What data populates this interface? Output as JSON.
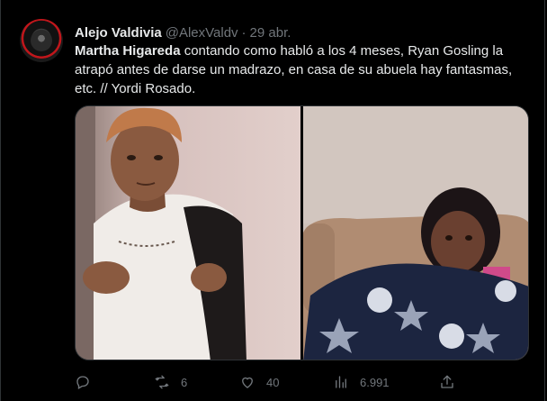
{
  "tweet": {
    "author_name": "Alejo Valdivia",
    "author_handle": "@AlexValdv",
    "separator": "·",
    "date": "29 abr.",
    "text_mention": "Martha Higareda",
    "text_body": " contando como habló a los 4 meses, Ryan Gosling la atrapó antes de darse un madrazo, en casa de su abuela hay fantasmas, etc. // Yordi Rosado."
  },
  "actions": {
    "reply": {
      "icon": "reply-icon",
      "count": ""
    },
    "retweet": {
      "icon": "retweet-icon",
      "count": "6"
    },
    "like": {
      "icon": "heart-icon",
      "count": "40"
    },
    "views": {
      "icon": "views-icon",
      "count": "6.991"
    },
    "share": {
      "icon": "share-icon",
      "count": ""
    }
  },
  "colors": {
    "background": "#000000",
    "text": "#e7e9ea",
    "muted": "#71767b",
    "border": "#2f3336"
  },
  "media": {
    "left_panel": "meme-left-person",
    "right_panel": "meme-right-person"
  }
}
